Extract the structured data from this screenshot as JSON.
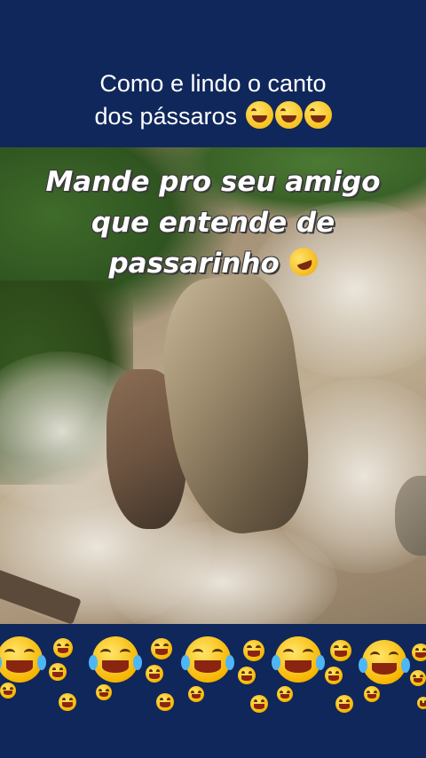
{
  "caption": {
    "line1": "Como e lindo o canto",
    "line2": "dos pássaros",
    "emoji_icons": [
      "tears-of-joy-icon",
      "tears-of-joy-icon",
      "tears-of-joy-icon"
    ]
  },
  "video": {
    "overlay_line1": "Mande pro seu amigo",
    "overlay_line2": "que entende de",
    "overlay_line3": "passarinho",
    "overlay_emoji_icon": "rolling-on-floor-laughing-icon"
  },
  "bottom_banner": {
    "emoji_icon": "tears-of-joy-icon"
  },
  "colors": {
    "background": "#10275b",
    "text": "#ffffff"
  }
}
